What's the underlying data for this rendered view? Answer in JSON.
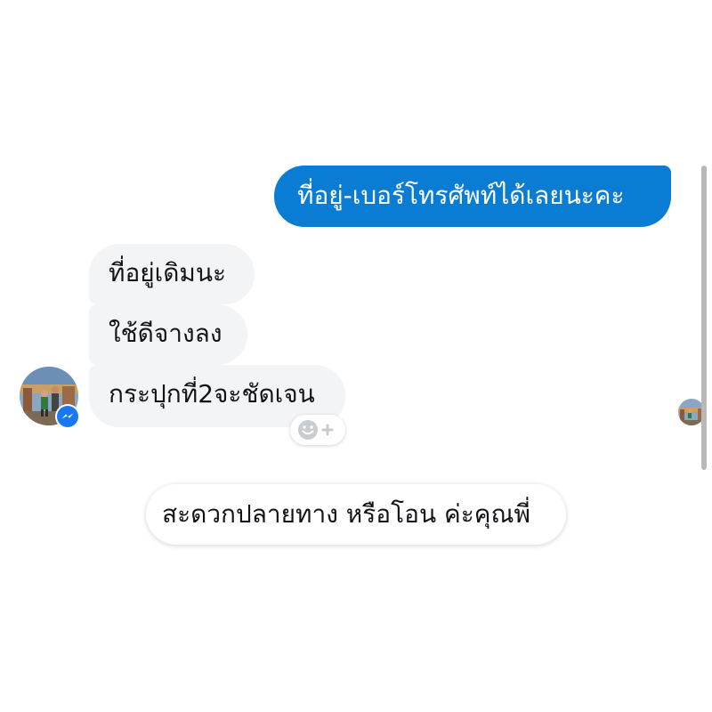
{
  "conversation": {
    "outgoing": [
      {
        "text": "ที่อยู่-เบอร์โทรศัพท์ได้เลยนะคะ"
      }
    ],
    "incoming": [
      {
        "text": "ที่อยู่เดิมนะ"
      },
      {
        "text": "ใช้ดีจางลง"
      },
      {
        "text": "กระปุกที่2จะชัดเจน"
      }
    ],
    "bottom_message": {
      "text": "สะดวกปลายทาง หรือโอน ค่ะคุณพี่"
    }
  },
  "icons": {
    "reaction": "add-reaction-icon",
    "badge": "messenger-icon"
  },
  "colors": {
    "outgoing_bubble": "#0a7cd3",
    "incoming_bubble": "#f3f4f6",
    "messenger_badge": "#1877f2",
    "text_dark": "#111418"
  }
}
